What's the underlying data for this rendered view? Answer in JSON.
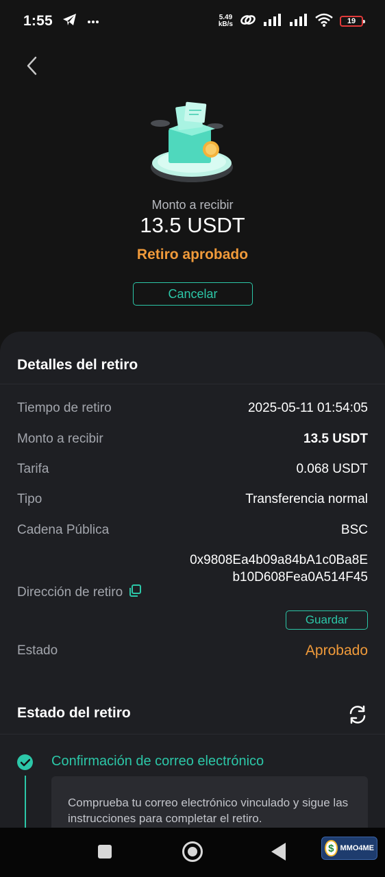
{
  "status_bar": {
    "time": "1:55",
    "net_speed_value": "5.49",
    "net_speed_unit": "kB/s",
    "battery": "19"
  },
  "header": {
    "amount_label": "Monto a recibir",
    "amount_value": "13.5 USDT",
    "status": "Retiro aprobado",
    "cancel_label": "Cancelar"
  },
  "details": {
    "title": "Detalles del retiro",
    "rows": [
      {
        "label": "Tiempo de retiro",
        "value": "2025-05-11 01:54:05"
      },
      {
        "label": "Monto a recibir",
        "value": "13.5 USDT"
      },
      {
        "label": "Tarifa",
        "value": "0.068 USDT"
      },
      {
        "label": "Tipo",
        "value": "Transferencia normal"
      },
      {
        "label": "Cadena Pública",
        "value": "BSC"
      }
    ],
    "address_label": "Dirección de retiro",
    "address_value": "0x9808Ea4b09a84bA1c0Ba8Eb10D608Fea0A514F45",
    "save_label": "Guardar",
    "state_label": "Estado",
    "state_value": "Aprobado"
  },
  "progress": {
    "title": "Estado del retiro",
    "step_title": "Confirmación de correo electrónico",
    "step_text": "Comprueba tu correo electrónico vinculado y sigue las instrucciones para completar el retiro."
  },
  "watermark": {
    "name": "MMO4ME"
  },
  "colors": {
    "accent": "#2cc7a8",
    "status_orange": "#f09a3a",
    "background": "#141414",
    "sheet": "#1e1f23"
  }
}
